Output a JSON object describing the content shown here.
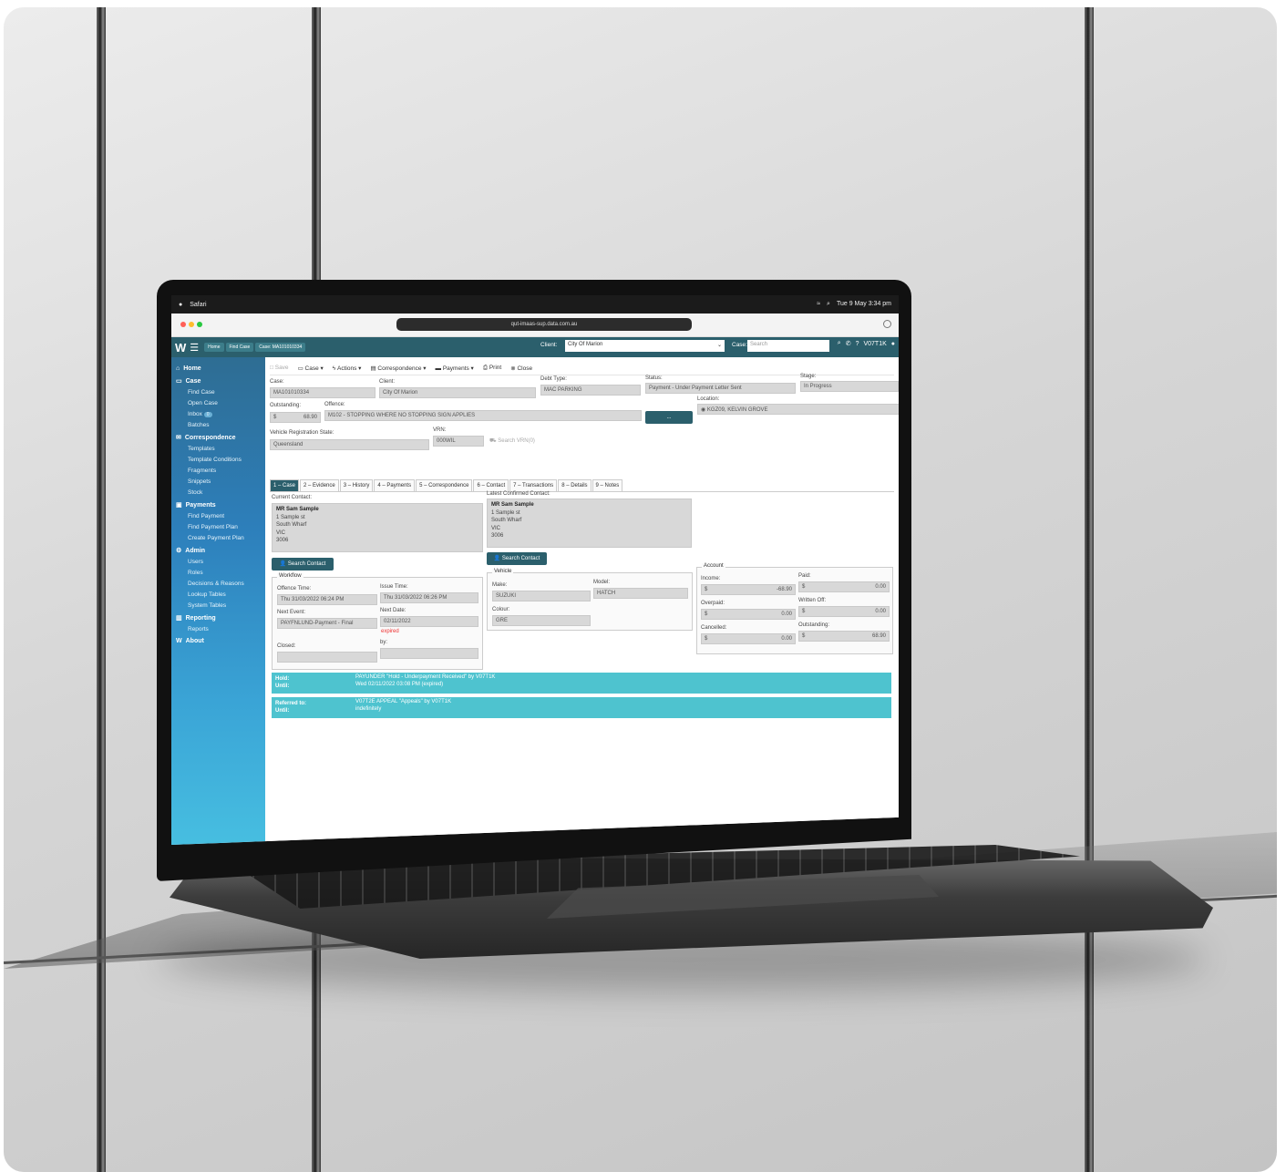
{
  "mac_menubar": {
    "apple": "",
    "app": "Safari",
    "datetime": "Tue 9 May 3:34 pm"
  },
  "browser": {
    "url": "qut-imaas-sup.data.com.au"
  },
  "topbar": {
    "logo": "W",
    "breadcrumbs": [
      "Home",
      "Find Case",
      "Case: MA101010334"
    ],
    "client_label": "Client:",
    "client_value": "City Of Marion",
    "case_label": "Case:",
    "case_placeholder": "Search",
    "user": "V07T1K"
  },
  "sidebar": {
    "home": "Home",
    "case": {
      "title": "Case",
      "items": [
        "Find Case",
        "Open Case",
        "Inbox",
        "Batches"
      ],
      "inbox_badge": "0"
    },
    "correspondence": {
      "title": "Correspondence",
      "items": [
        "Templates",
        "Template Conditions",
        "Fragments",
        "Snippets",
        "Stock"
      ]
    },
    "payments": {
      "title": "Payments",
      "items": [
        "Find Payment",
        "Find Payment Plan",
        "Create Payment Plan"
      ]
    },
    "admin": {
      "title": "Admin",
      "items": [
        "Users",
        "Roles",
        "Decisions & Reasons",
        "Lookup Tables",
        "System Tables"
      ]
    },
    "reporting": {
      "title": "Reporting",
      "items": [
        "Reports"
      ]
    },
    "about": "About"
  },
  "toolbar": {
    "save": "Save",
    "case": "Case",
    "actions": "Actions",
    "correspondence": "Correspondence",
    "payments": "Payments",
    "print": "Print",
    "close": "Close"
  },
  "case_form": {
    "case_label": "Case:",
    "case_value": "MA101010334",
    "client_label": "Client:",
    "client_value": "City Of Marion",
    "debt_type_label": "Debt Type:",
    "debt_type_value": "MAC PARKING",
    "status_label": "Status:",
    "status_value": "Payment - Under Payment Letter Sent",
    "stage_label": "Stage:",
    "stage_value": "In Progress",
    "outstanding_label": "Outstanding:",
    "outstanding_currency": "$",
    "outstanding_value": "68.90",
    "offence_label": "Offence:",
    "offence_value": "M102 - STOPPING WHERE NO STOPPING SIGN APPLIES",
    "offence_button": "...",
    "location_label": "Location:",
    "location_value": "KGZ09, KELVIN GROVE",
    "vrs_label": "Vehicle Registration State:",
    "vrs_value": "Queensland",
    "vrn_label": "VRN:",
    "vrn_value": "000WIL",
    "search_vrn": "Search VRN(0)"
  },
  "tabs": [
    "1 – Case",
    "2 – Evidence",
    "3 – History",
    "4 – Payments",
    "5 – Correspondence",
    "6 – Contact",
    "7 – Transactions",
    "8 – Details",
    "9 – Notes"
  ],
  "contacts": {
    "current_label": "Current Contact:",
    "current": {
      "name": "MR Sam Sample",
      "lines": [
        "1 Sample st",
        "South Wharf",
        "VIC",
        "3006"
      ]
    },
    "latest_label": "Latest Confirmed Contact:",
    "latest": {
      "name": "MR Sam Sample",
      "lines": [
        "1 Sample st",
        "South Wharf",
        "VIC",
        "3006"
      ]
    },
    "search_button": "Search Contact"
  },
  "workflow": {
    "title": "Workflow",
    "offence_time_label": "Offence Time:",
    "offence_time": "Thu 31/03/2022 06:24 PM",
    "issue_time_label": "Issue Time:",
    "issue_time": "Thu 31/03/2022 06:26 PM",
    "next_event_label": "Next Event:",
    "next_event": "PAYFNLUND-Payment - Final",
    "next_date_label": "Next Date:",
    "next_date": "02/11/2022",
    "expired": "expired",
    "closed_label": "Closed:",
    "closed": "",
    "by_label": "by:",
    "by": ""
  },
  "vehicle": {
    "title": "Vehicle",
    "make_label": "Make:",
    "make": "SUZUKI",
    "model_label": "Model:",
    "model": "HATCH",
    "colour_label": "Colour:",
    "colour": "GRE"
  },
  "account": {
    "title": "Account",
    "income_label": "Income:",
    "income": "-68.90",
    "paid_label": "Paid:",
    "paid": "0.00",
    "overpaid_label": "Overpaid:",
    "overpaid": "0.00",
    "written_off_label": "Written Off:",
    "written_off": "0.00",
    "cancelled_label": "Cancelled:",
    "cancelled": "0.00",
    "outstanding_label": "Outstanding:",
    "outstanding": "68.90",
    "currency": "$"
  },
  "banners": [
    {
      "k1": "Hold:",
      "v1": "PAYUNDER \"Hold - Underpayment Received\" by V07T1K",
      "k2": "Until:",
      "v2": "Wed 02/11/2022 03:08 PM (expired)"
    },
    {
      "k1": "Referred to:",
      "v1": "V07T2E APPEAL \"Appeals\" by V07T1K",
      "k2": "Until:",
      "v2": "indefinitely"
    }
  ],
  "colors": {
    "topbar": "#2b5f6c",
    "banner": "#4ec3cf",
    "sidebar_top": "#2e6d93",
    "sidebar_bottom": "#47bfe1"
  }
}
